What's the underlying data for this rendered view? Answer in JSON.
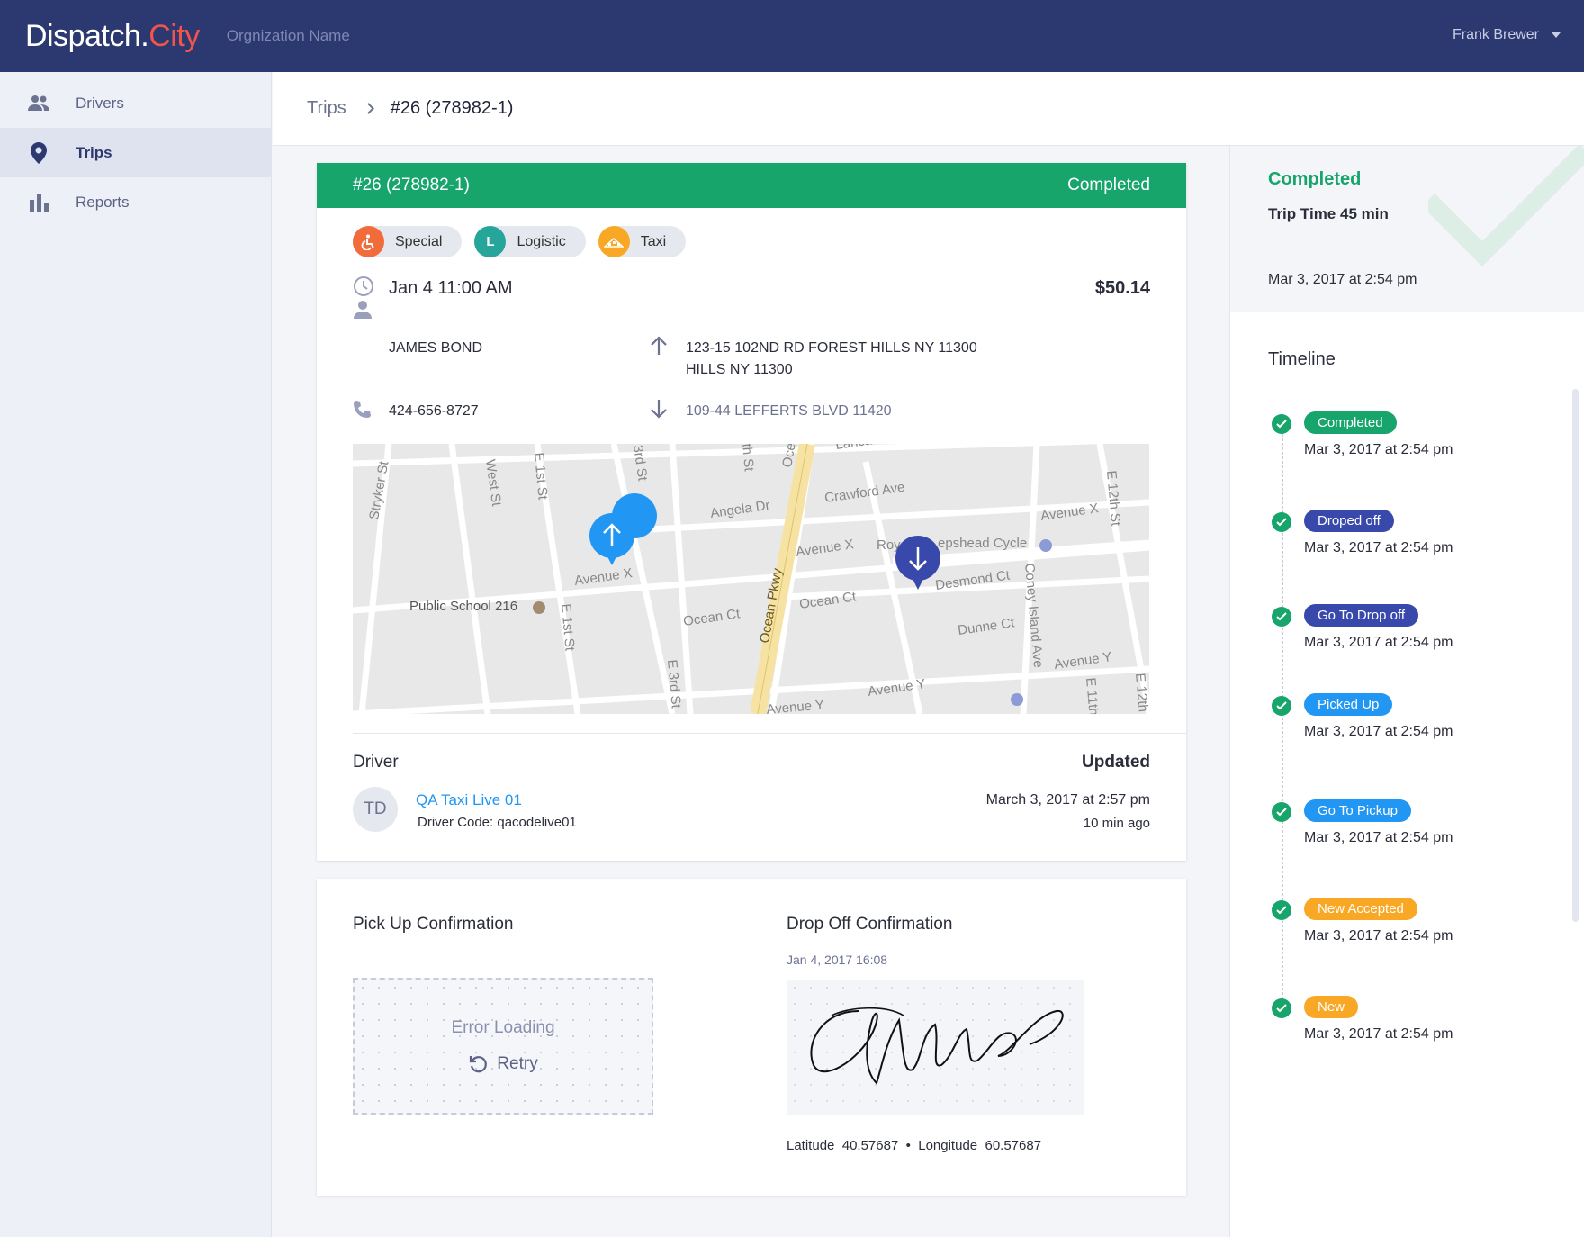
{
  "app": {
    "brand_main": "Dispatch.",
    "brand_accent": "City",
    "org_name": "Orgnization Name",
    "user_name": "Frank Brewer"
  },
  "sidebar": {
    "items": [
      {
        "label": "Drivers",
        "icon": "people-icon",
        "active": false
      },
      {
        "label": "Trips",
        "icon": "map-pin-icon",
        "active": true
      },
      {
        "label": "Reports",
        "icon": "bar-chart-icon",
        "active": false
      }
    ]
  },
  "breadcrumb": {
    "parent": "Trips",
    "current": "#26 (278982-1)"
  },
  "trip": {
    "id": "#26 (278982-1)",
    "status": "Completed",
    "tags": [
      {
        "label": "Special",
        "icon": "wheelchair-icon",
        "color": "#f26b3a"
      },
      {
        "label": "Logistic",
        "icon": "L",
        "color": "#26a69a"
      },
      {
        "label": "Taxi",
        "icon": "taxi-icon",
        "color": "#f9a825"
      }
    ],
    "datetime": "Jan 4 11:00 AM",
    "price": "$50.14",
    "passenger_name": "JAMES BOND",
    "phone": "424-656-8727",
    "pickup_address_line1": "123-15 102ND RD FOREST HILLS NY 11300",
    "pickup_address_line2": "HILLS NY 11300",
    "dropoff_address": "109-44 LEFFERTS BLVD 11420"
  },
  "map": {
    "street_labels": [
      "Stryker St",
      "West St",
      "E 1st St",
      "3rd St",
      "th St",
      "Oce",
      "Lancas",
      "Crawford Ave",
      "Angela Dr",
      "Avenue X",
      "Avenue X",
      "Avenue X",
      "Roy",
      "epshead Cycle",
      "Public School 216",
      "E 1st St",
      "Ocean Ct",
      "Ocean Ct",
      "Ocean Pkwy",
      "Desmond Ct",
      "Dunne Ct",
      "Coney Island Ave",
      "E 12th St",
      "Avenue Y",
      "Avenue Y",
      "Avenue Y",
      "E 3rd St",
      "E 11th",
      "E 12th"
    ]
  },
  "driver": {
    "section_label": "Driver",
    "updated_label": "Updated",
    "initials": "TD",
    "name": "QA Taxi Live 01",
    "code": "Driver Code: qacodelive01",
    "updated_date": "March 3, 2017 at 2:57 pm",
    "updated_ago": "10 min ago"
  },
  "confirmation": {
    "pickup_title": "Pick Up Confirmation",
    "error_text": "Error Loading",
    "retry_label": "Retry",
    "dropoff_title": "Drop Off Confirmation",
    "dropoff_date": "Jan 4, 2017 16:08",
    "latitude_label": "Latitude",
    "latitude": "40.57687",
    "longitude_label": "Longitude",
    "longitude": "60.57687"
  },
  "status_panel": {
    "title": "Completed",
    "trip_time": "Trip Time 45 min",
    "date": "Mar 3, 2017 at 2:54 pm"
  },
  "timeline": {
    "title": "Timeline",
    "items": [
      {
        "label": "Completed",
        "color": "#17a56b",
        "date": "Mar 3, 2017 at 2:54 pm"
      },
      {
        "label": "Droped off",
        "color": "#3949ab",
        "date": "Mar 3, 2017 at 2:54 pm"
      },
      {
        "label": "Go To Drop off",
        "color": "#3949ab",
        "date": "Mar 3, 2017 at 2:54 pm"
      },
      {
        "label": "Picked Up",
        "color": "#2196f3",
        "date": "Mar 3, 2017 at 2:54 pm"
      },
      {
        "label": "Go To Pickup",
        "color": "#2196f3",
        "date": "Mar 3, 2017 at 2:54 pm"
      },
      {
        "label": "New Accepted",
        "color": "#f9a825",
        "date": "Mar 3, 2017 at 2:54 pm"
      },
      {
        "label": "New",
        "color": "#f9a825",
        "date": "Mar 3, 2017 at 2:54 pm"
      }
    ]
  }
}
